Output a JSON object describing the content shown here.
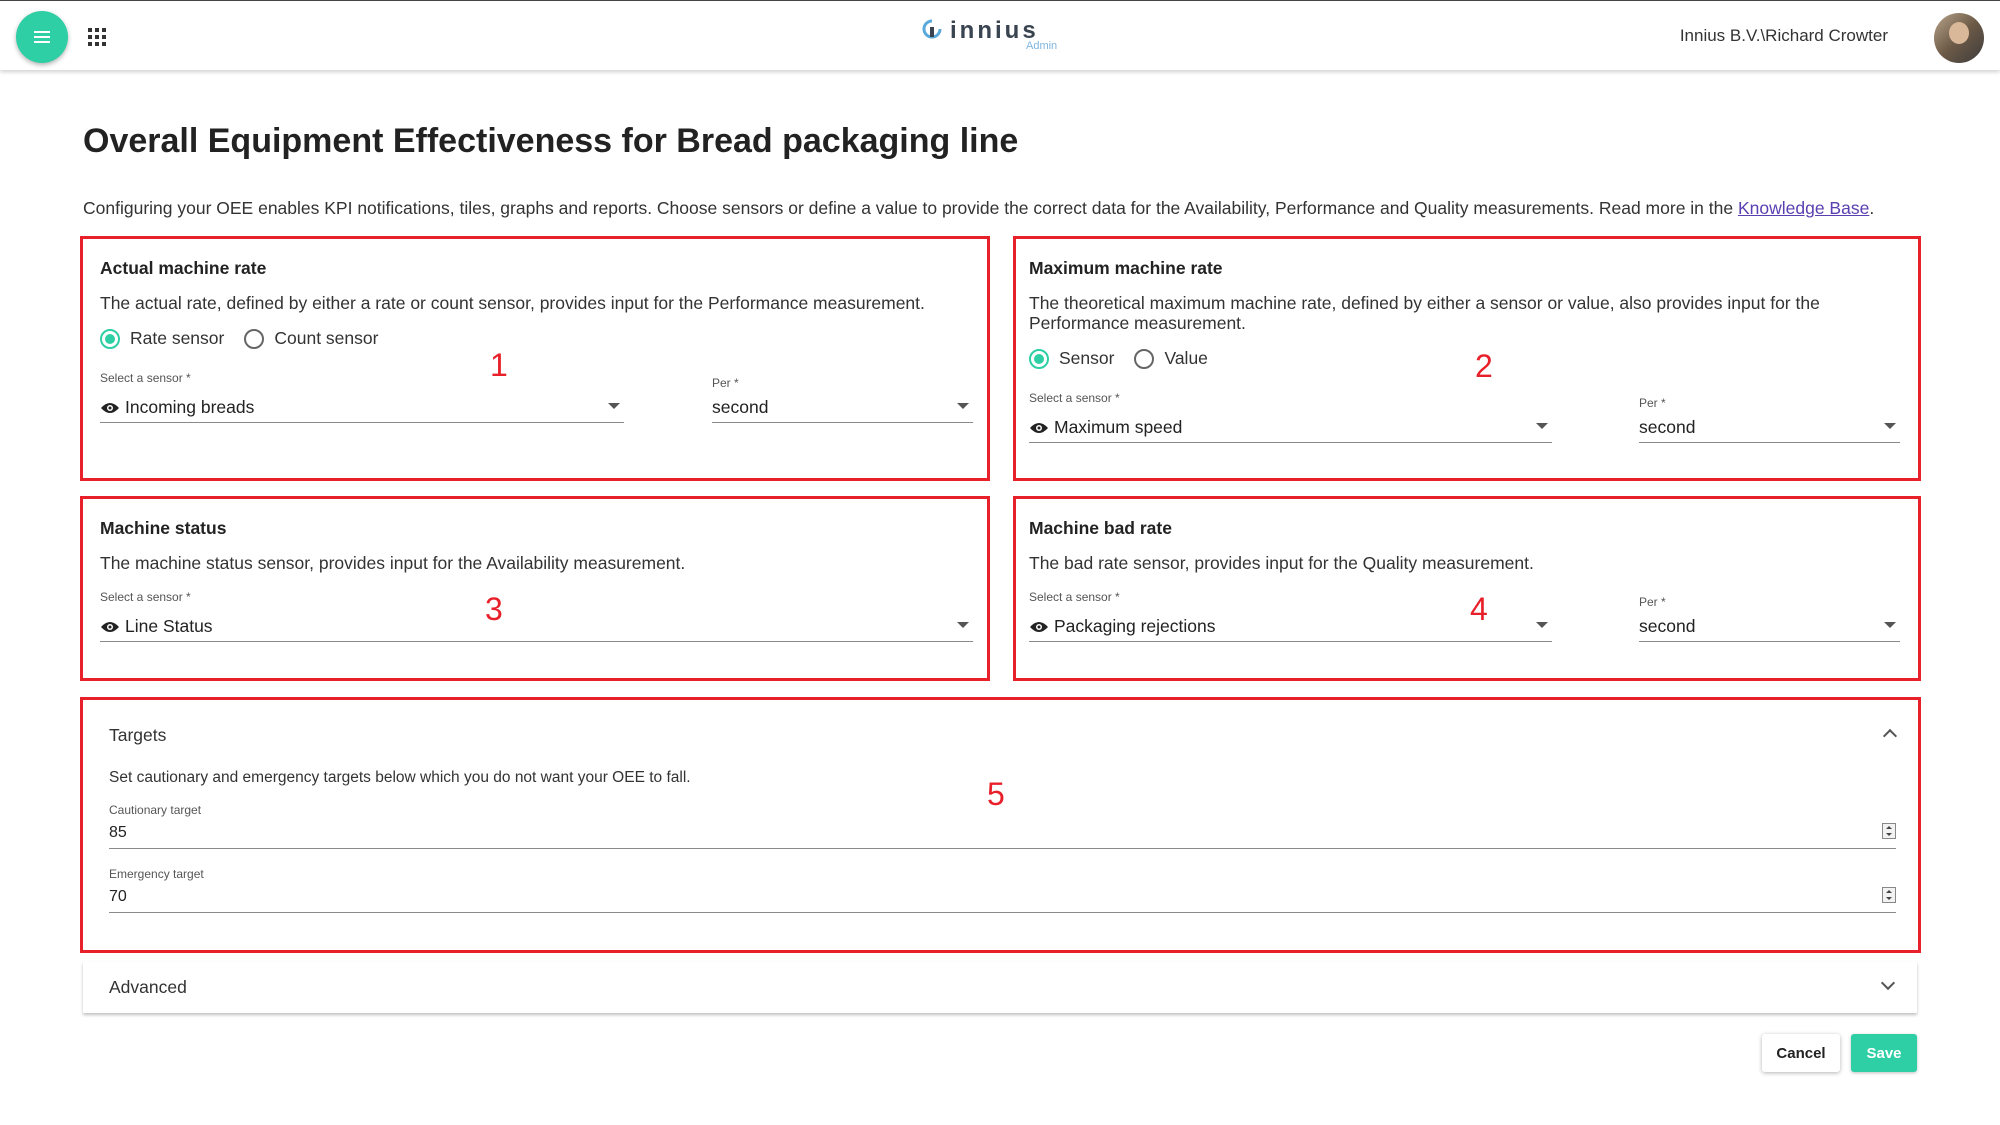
{
  "header": {
    "logo_text": "innius",
    "logo_sub": "Admin",
    "user": "Innius B.V.\\Richard Crowter"
  },
  "page": {
    "title": "Overall Equipment Effectiveness for Bread packaging line",
    "description": "Configuring your OEE enables KPI notifications, tiles, graphs and reports. Choose sensors or define a value to provide the correct data for the Availability, Performance and Quality measurements. Read more in the",
    "link_text": "Knowledge Base",
    "link_suffix": "."
  },
  "cards": {
    "actual": {
      "title": "Actual machine rate",
      "desc": "The actual rate, defined by either a rate or count sensor, provides input for the Performance measurement.",
      "radio_1": "Rate sensor",
      "radio_2": "Count sensor",
      "selected_radio": "Rate sensor",
      "sensor_label": "Select a sensor *",
      "sensor_value": "Incoming breads",
      "per_label": "Per *",
      "per_value": "second",
      "annotation": "1"
    },
    "maximum": {
      "title": "Maximum machine rate",
      "desc": "The theoretical maximum machine rate, defined by either a sensor or value, also provides input for the Performance measurement.",
      "radio_1": "Sensor",
      "radio_2": "Value",
      "selected_radio": "Sensor",
      "sensor_label": "Select a sensor *",
      "sensor_value": "Maximum speed",
      "per_label": "Per *",
      "per_value": "second",
      "annotation": "2"
    },
    "status": {
      "title": "Machine status",
      "desc": "The machine status sensor, provides input for the Availability measurement.",
      "sensor_label": "Select a sensor *",
      "sensor_value": "Line Status",
      "annotation": "3"
    },
    "bad": {
      "title": "Machine bad rate",
      "desc": "The bad rate sensor, provides input for the Quality measurement.",
      "sensor_label": "Select a sensor *",
      "sensor_value": "Packaging rejections",
      "per_label": "Per *",
      "per_value": "second",
      "annotation": "4"
    }
  },
  "targets": {
    "title": "Targets",
    "desc": "Set cautionary and emergency targets below which you do not want your OEE to fall.",
    "cautionary_label": "Cautionary target",
    "cautionary_value": "85",
    "emergency_label": "Emergency target",
    "emergency_value": "70",
    "annotation": "5"
  },
  "advanced": {
    "title": "Advanced"
  },
  "actions": {
    "cancel": "Cancel",
    "save": "Save"
  },
  "colors": {
    "accent": "#2ecfa5",
    "annotation": "#e8202a",
    "link": "#5a3fb0"
  }
}
